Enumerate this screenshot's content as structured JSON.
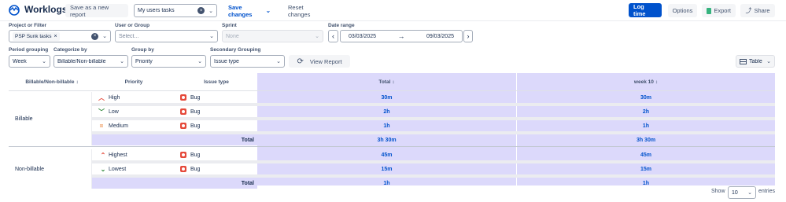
{
  "app": {
    "title": "Worklogs"
  },
  "toolbar": {
    "save_new": "Save as a new report",
    "report_select": "My users tasks",
    "save_changes": "Save changes",
    "reset": "Reset changes",
    "log_time": "Log time",
    "options": "Options",
    "export": "Export",
    "share": "Share"
  },
  "filters": {
    "project_label": "Project or Filter",
    "project_tag": "PSP Sunk tasks",
    "user_label": "User or Group",
    "user_placeholder": "Select...",
    "sprint_label": "Sprint",
    "sprint_value": "None",
    "date_label": "Date range",
    "date_from": "03/03/2025",
    "date_to": "09/03/2025",
    "period_label": "Period grouping",
    "period_value": "Week",
    "categorize_label": "Categorize by",
    "categorize_value": "Billable/Non-billable",
    "group_label": "Group by",
    "group_value": "Priority",
    "secondary_label": "Secondary Grouping",
    "secondary_value": "Issue type",
    "view_report": "View Report",
    "view_mode": "Table"
  },
  "table": {
    "headers": {
      "category": "Billable/Non-billable",
      "priority": "Priority",
      "issue_type": "Issue type",
      "total": "Total",
      "week": "week 10"
    },
    "groups": [
      {
        "name": "Billable",
        "rows": [
          {
            "priority": "High",
            "icon": "arrow-up-icon",
            "color": "#e5493a",
            "issue": "Bug",
            "total": "30m",
            "week": "30m"
          },
          {
            "priority": "Low",
            "icon": "arrow-down-icon",
            "color": "#2d8738",
            "issue": "Bug",
            "total": "2h",
            "week": "2h"
          },
          {
            "priority": "Medium",
            "icon": "equals-icon",
            "color": "#e97f33",
            "issue": "Bug",
            "total": "1h",
            "week": "1h"
          }
        ],
        "total_label": "Total",
        "total": "3h 30m",
        "week_total": "3h 30m"
      },
      {
        "name": "Non-billable",
        "rows": [
          {
            "priority": "Highest",
            "icon": "double-up-icon",
            "color": "#e5493a",
            "issue": "Bug",
            "total": "45m",
            "week": "45m"
          },
          {
            "priority": "Lowest",
            "icon": "double-down-icon",
            "color": "#2d8738",
            "issue": "Bug",
            "total": "15m",
            "week": "15m"
          }
        ],
        "total_label": "Total",
        "total": "1h",
        "week_total": "1h"
      }
    ]
  },
  "footer": {
    "show": "Show",
    "entries_value": "10",
    "entries": "entries"
  },
  "colors": {
    "accent": "#0052cc",
    "highlight": "#dcd9fb",
    "bug": "#e5493a"
  }
}
